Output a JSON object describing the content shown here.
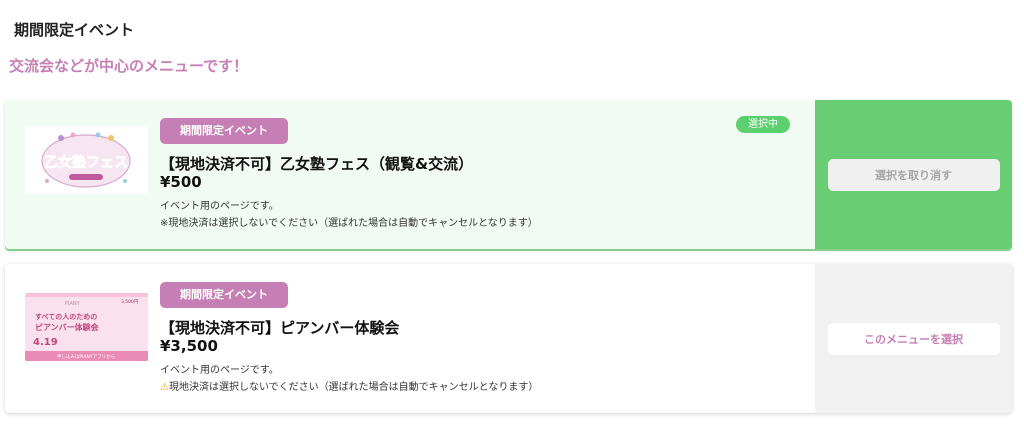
{
  "section": {
    "title": "期間限定イベント",
    "subtitle": "交流会などが中心のメニューです！"
  },
  "colors": {
    "accent_pink": "#c67fb4",
    "selected_green": "#68cd73",
    "selected_bg": "#f2fbf3"
  },
  "menus": [
    {
      "tag": "期間限定イベント",
      "title": "【現地決済不可】乙女塾フェス（観覧&交流）",
      "price": "¥500",
      "description": "イベント用のページです。",
      "note": "※現地決済は選択しないでください（選ばれた場合は自動でキャンセルとなります）",
      "selected": true,
      "badge": "選択中",
      "action_label": "選択を取り消す",
      "image": {
        "logo_text": "乙女塾フェス"
      }
    },
    {
      "tag": "期間限定イベント",
      "title": "【現地決済不可】ピアンバー体験会",
      "price": "¥3,500",
      "description": "イベント用のページです。",
      "note_icon": "warning-icon",
      "note": "現地決済は選択しないでください（選ばれた場合は自動でキャンセルとなります）",
      "selected": false,
      "action_label": "このメニューを選択",
      "image": {
        "brand": "PIANY",
        "price_text": "3,500円",
        "headline_1": "すべての人のための",
        "headline_2": "ピアンバー体験会",
        "date": "4.19",
        "footer": "申し込みはPIANYアプリから"
      }
    }
  ]
}
